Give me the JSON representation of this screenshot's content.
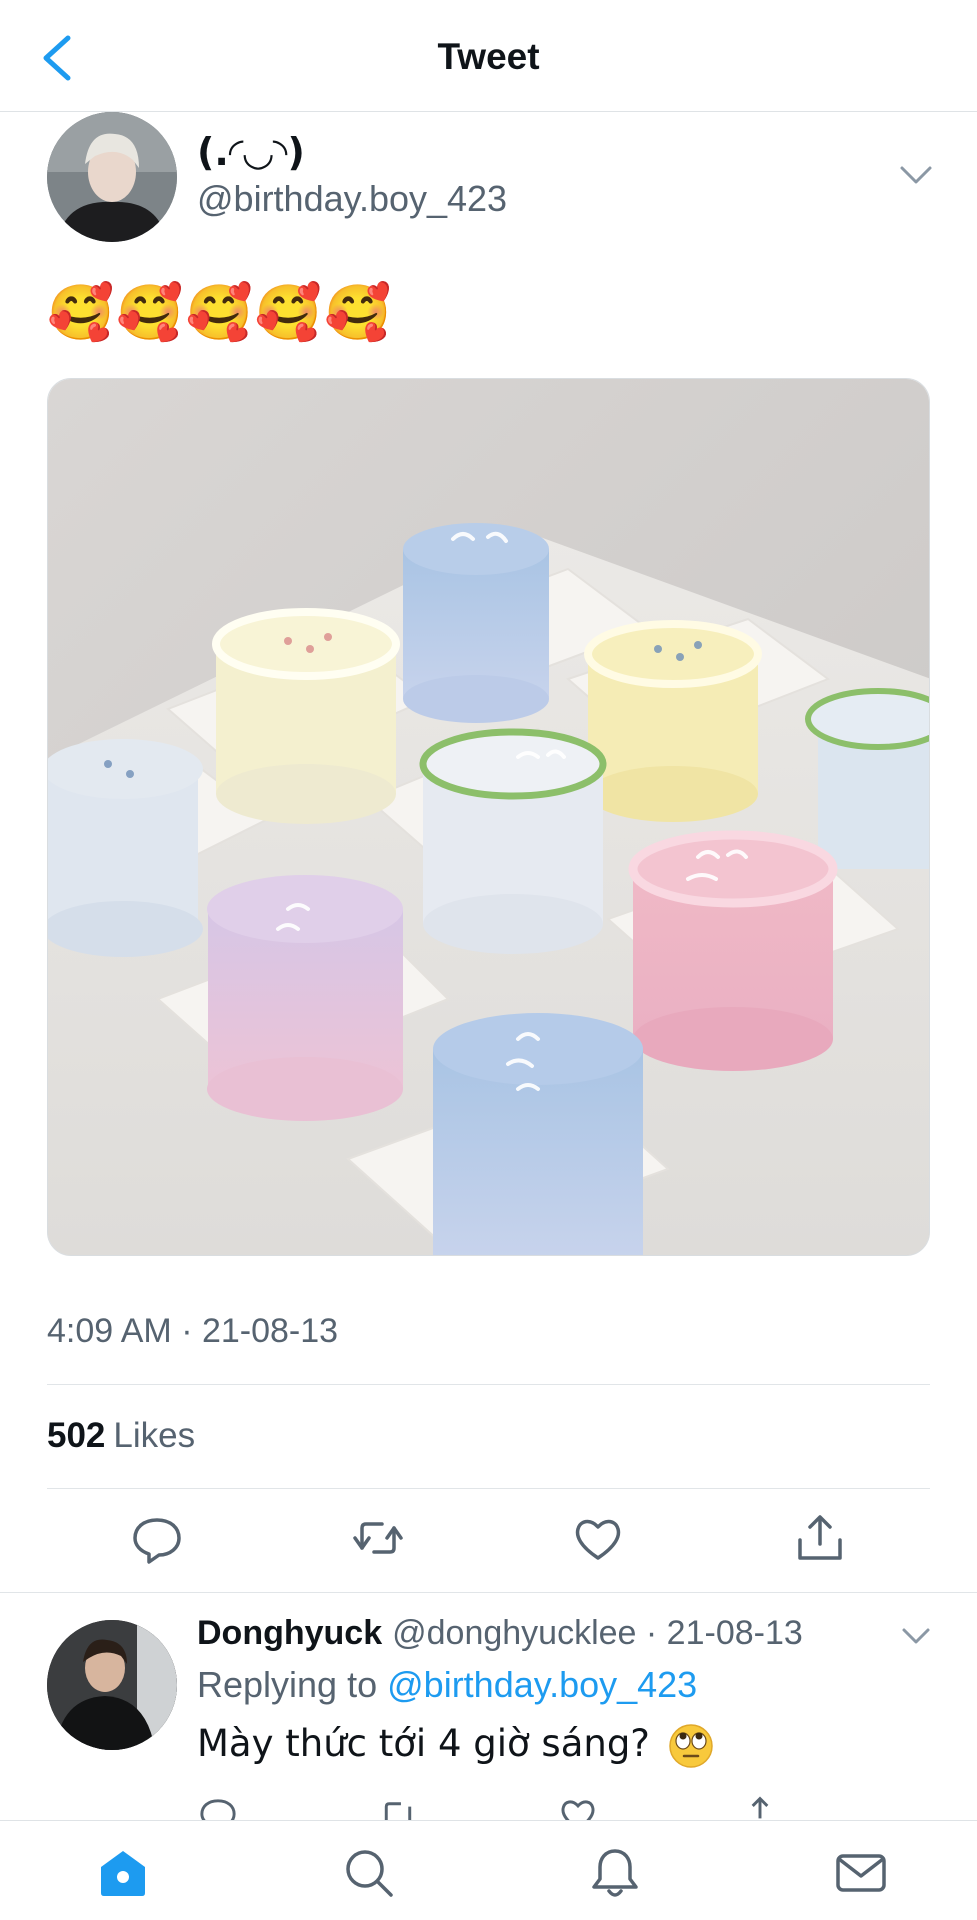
{
  "header": {
    "title": "Tweet"
  },
  "tweet": {
    "display_name": "(.◜◡◝)",
    "handle": "@birthday.boy_423",
    "text": "🥰🥰🥰🥰🥰",
    "timestamp": "4:09 AM · 21-08-13",
    "likes_count": "502",
    "likes_label": "Likes"
  },
  "reply": {
    "name": "Donghyuck",
    "handle_time": "@donghyucklee · 21-08-13",
    "replying_prefix": "Replying to",
    "replying_to": "@birthday.boy_423",
    "text": "Mày thức tới 4 giờ sáng?"
  },
  "colors": {
    "accent": "#1d9bf0",
    "secondary_text": "#566370",
    "icon": "#566370"
  }
}
